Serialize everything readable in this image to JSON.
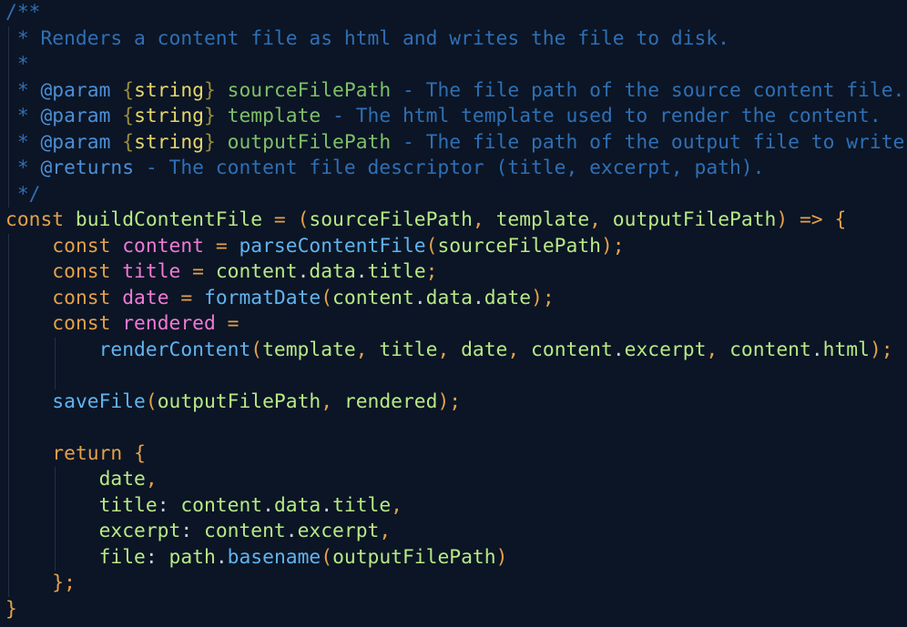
{
  "editor": {
    "language": "javascript",
    "theme": {
      "background": "#0b1525",
      "comment": "#2f6fb5",
      "doctag": "#4d8fd6",
      "type": "#e6d66a",
      "param": "#7fbf6a",
      "keyword": "#e5a04a",
      "identifier": "#b8e986",
      "variable": "#f07ad6",
      "function": "#61b4f0",
      "indent_guide": "#233146"
    },
    "lines": [
      [
        [
          "/**",
          "c-comment"
        ]
      ],
      [
        [
          " * Renders a content file as html and writes the file to disk.",
          "c-comment"
        ]
      ],
      [
        [
          " *",
          "c-comment"
        ]
      ],
      [
        [
          " * ",
          "c-comment"
        ],
        [
          "@param",
          "c-doctag"
        ],
        [
          " ",
          "c-comment"
        ],
        [
          "{",
          "c-brace-t"
        ],
        [
          "string",
          "c-type"
        ],
        [
          "}",
          "c-brace-t"
        ],
        [
          " ",
          "c-comment"
        ],
        [
          "sourceFilePath",
          "c-param"
        ],
        [
          " - The file path of the source content file.",
          "c-comment"
        ]
      ],
      [
        [
          " * ",
          "c-comment"
        ],
        [
          "@param",
          "c-doctag"
        ],
        [
          " ",
          "c-comment"
        ],
        [
          "{",
          "c-brace-t"
        ],
        [
          "string",
          "c-type"
        ],
        [
          "}",
          "c-brace-t"
        ],
        [
          " ",
          "c-comment"
        ],
        [
          "template",
          "c-param"
        ],
        [
          " - The html template used to render the content.",
          "c-comment"
        ]
      ],
      [
        [
          " * ",
          "c-comment"
        ],
        [
          "@param",
          "c-doctag"
        ],
        [
          " ",
          "c-comment"
        ],
        [
          "{",
          "c-brace-t"
        ],
        [
          "string",
          "c-type"
        ],
        [
          "}",
          "c-brace-t"
        ],
        [
          " ",
          "c-comment"
        ],
        [
          "outputFilePath",
          "c-param"
        ],
        [
          " - The file path of the output file to write.",
          "c-comment"
        ]
      ],
      [
        [
          " * ",
          "c-comment"
        ],
        [
          "@returns",
          "c-doctag"
        ],
        [
          " - The content file descriptor (title, excerpt, path).",
          "c-comment"
        ]
      ],
      [
        [
          " */",
          "c-comment"
        ]
      ],
      [
        [
          "const",
          "c-keyword"
        ],
        [
          " buildContentFile ",
          "c-ident"
        ],
        [
          "=",
          "c-punct"
        ],
        [
          " ",
          "c-text"
        ],
        [
          "(",
          "c-punct"
        ],
        [
          "sourceFilePath",
          "c-ident"
        ],
        [
          ", ",
          "c-punct"
        ],
        [
          "template",
          "c-ident"
        ],
        [
          ", ",
          "c-punct"
        ],
        [
          "outputFilePath",
          "c-ident"
        ],
        [
          ")",
          "c-punct"
        ],
        [
          " ",
          "c-text"
        ],
        [
          "=>",
          "c-punct"
        ],
        [
          " ",
          "c-text"
        ],
        [
          "{",
          "c-punct"
        ]
      ],
      [
        [
          "    ",
          "c-text"
        ],
        [
          "const",
          "c-keyword"
        ],
        [
          " ",
          "c-text"
        ],
        [
          "content",
          "c-var"
        ],
        [
          " = ",
          "c-punct"
        ],
        [
          "parseContentFile",
          "c-func"
        ],
        [
          "(",
          "c-punct"
        ],
        [
          "sourceFilePath",
          "c-ident"
        ],
        [
          ");",
          "c-punct"
        ]
      ],
      [
        [
          "    ",
          "c-text"
        ],
        [
          "const",
          "c-keyword"
        ],
        [
          " ",
          "c-text"
        ],
        [
          "title",
          "c-var"
        ],
        [
          " = ",
          "c-punct"
        ],
        [
          "content",
          "c-ident"
        ],
        [
          ".",
          "c-text"
        ],
        [
          "data",
          "c-ident"
        ],
        [
          ".",
          "c-text"
        ],
        [
          "title",
          "c-ident"
        ],
        [
          ";",
          "c-punct"
        ]
      ],
      [
        [
          "    ",
          "c-text"
        ],
        [
          "const",
          "c-keyword"
        ],
        [
          " ",
          "c-text"
        ],
        [
          "date",
          "c-var"
        ],
        [
          " = ",
          "c-punct"
        ],
        [
          "formatDate",
          "c-func"
        ],
        [
          "(",
          "c-punct"
        ],
        [
          "content",
          "c-ident"
        ],
        [
          ".",
          "c-text"
        ],
        [
          "data",
          "c-ident"
        ],
        [
          ".",
          "c-text"
        ],
        [
          "date",
          "c-ident"
        ],
        [
          ");",
          "c-punct"
        ]
      ],
      [
        [
          "    ",
          "c-text"
        ],
        [
          "const",
          "c-keyword"
        ],
        [
          " ",
          "c-text"
        ],
        [
          "rendered",
          "c-var"
        ],
        [
          " =",
          "c-punct"
        ]
      ],
      [
        [
          "        ",
          "c-text"
        ],
        [
          "renderContent",
          "c-func"
        ],
        [
          "(",
          "c-punct"
        ],
        [
          "template",
          "c-ident"
        ],
        [
          ", ",
          "c-punct"
        ],
        [
          "title",
          "c-ident"
        ],
        [
          ", ",
          "c-punct"
        ],
        [
          "date",
          "c-ident"
        ],
        [
          ", ",
          "c-punct"
        ],
        [
          "content",
          "c-ident"
        ],
        [
          ".",
          "c-text"
        ],
        [
          "excerpt",
          "c-ident"
        ],
        [
          ", ",
          "c-punct"
        ],
        [
          "content",
          "c-ident"
        ],
        [
          ".",
          "c-text"
        ],
        [
          "html",
          "c-ident"
        ],
        [
          ");",
          "c-punct"
        ]
      ],
      [],
      [
        [
          "    ",
          "c-text"
        ],
        [
          "saveFile",
          "c-func"
        ],
        [
          "(",
          "c-punct"
        ],
        [
          "outputFilePath",
          "c-ident"
        ],
        [
          ", ",
          "c-punct"
        ],
        [
          "rendered",
          "c-ident"
        ],
        [
          ");",
          "c-punct"
        ]
      ],
      [],
      [
        [
          "    ",
          "c-text"
        ],
        [
          "return",
          "c-keyword"
        ],
        [
          " ",
          "c-text"
        ],
        [
          "{",
          "c-punct"
        ]
      ],
      [
        [
          "        ",
          "c-text"
        ],
        [
          "date",
          "c-ident"
        ],
        [
          ",",
          "c-punct"
        ]
      ],
      [
        [
          "        ",
          "c-text"
        ],
        [
          "title",
          "c-ident"
        ],
        [
          ": ",
          "c-text"
        ],
        [
          "content",
          "c-ident"
        ],
        [
          ".",
          "c-text"
        ],
        [
          "data",
          "c-ident"
        ],
        [
          ".",
          "c-text"
        ],
        [
          "title",
          "c-ident"
        ],
        [
          ",",
          "c-punct"
        ]
      ],
      [
        [
          "        ",
          "c-text"
        ],
        [
          "excerpt",
          "c-ident"
        ],
        [
          ": ",
          "c-text"
        ],
        [
          "content",
          "c-ident"
        ],
        [
          ".",
          "c-text"
        ],
        [
          "excerpt",
          "c-ident"
        ],
        [
          ",",
          "c-punct"
        ]
      ],
      [
        [
          "        ",
          "c-text"
        ],
        [
          "file",
          "c-ident"
        ],
        [
          ": ",
          "c-text"
        ],
        [
          "path",
          "c-ident"
        ],
        [
          ".",
          "c-text"
        ],
        [
          "basename",
          "c-func"
        ],
        [
          "(",
          "c-punct"
        ],
        [
          "outputFilePath",
          "c-ident"
        ],
        [
          ")",
          "c-punct"
        ]
      ],
      [
        [
          "    ",
          "c-text"
        ],
        [
          "};",
          "c-punct"
        ]
      ],
      [
        [
          "}",
          "c-punct"
        ]
      ]
    ]
  }
}
